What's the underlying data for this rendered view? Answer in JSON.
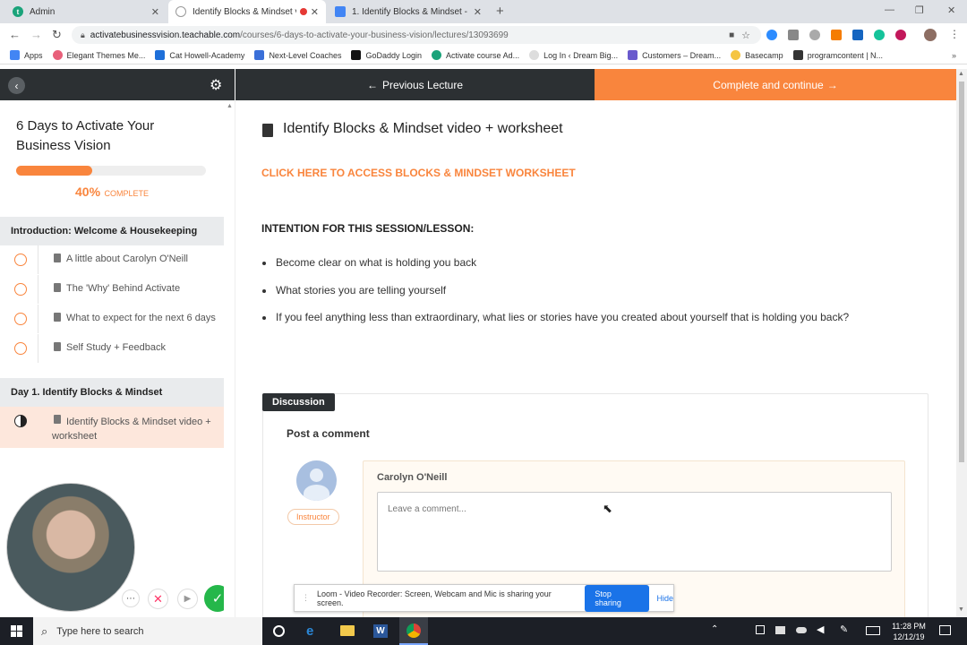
{
  "browser": {
    "tabs": [
      {
        "title": "Admin",
        "favicon_color": "#1aa37a",
        "favicon_glyph": "t"
      },
      {
        "title": "Identify Blocks & Mindset vi",
        "favicon_color": "#ffffff",
        "favicon_glyph": ""
      },
      {
        "title": "1. Identify Blocks & Mindset - Go",
        "favicon_color": "#4285f4",
        "favicon_glyph": ""
      }
    ],
    "url_host": "activatebusinessvision.teachable.com",
    "url_path": "/courses/6-days-to-activate-your-business-vision/lectures/13093699",
    "bookmarks": [
      {
        "label": "Apps",
        "color": "#4285f4"
      },
      {
        "label": "Elegant Themes Me...",
        "color": "#e8607a"
      },
      {
        "label": "Cat Howell-Academy",
        "color": "#1e6fd9"
      },
      {
        "label": "Next-Level Coaches",
        "color": "#3a6fd8"
      },
      {
        "label": "GoDaddy Login",
        "color": "#111111"
      },
      {
        "label": "Activate course Ad...",
        "color": "#1aa37a"
      },
      {
        "label": "Log In ‹ Dream Big...",
        "color": "#cccccc"
      },
      {
        "label": "Customers – Dream...",
        "color": "#6a5acd"
      },
      {
        "label": "Basecamp",
        "color": "#f5c542"
      },
      {
        "label": "programcontent | N...",
        "color": "#333333"
      }
    ]
  },
  "nav": {
    "prev_label": "Previous Lecture",
    "next_label": "Complete and continue"
  },
  "sidebar": {
    "course_title": "6 Days to Activate Your Business Vision",
    "progress_percent": "40%",
    "progress_label": "COMPLETE",
    "progress_value": 0.4,
    "sections": [
      {
        "title": "Introduction: Welcome & Housekeeping",
        "items": [
          "A little about Carolyn O'Neill",
          "The 'Why' Behind Activate",
          "What to expect for the next 6 days",
          "Self Study + Feedback"
        ]
      },
      {
        "title": "Day 1. Identify Blocks & Mindset",
        "items": [
          "Identify Blocks & Mindset video + worksheet"
        ]
      }
    ]
  },
  "lecture": {
    "title": "Identify Blocks & Mindset video + worksheet",
    "worksheet_link": "CLICK HERE TO ACCESS BLOCKS & MINDSET WORKSHEET",
    "intention_heading": "INTENTION FOR THIS SESSION/LESSON:",
    "bullets": [
      "Become clear on what is holding you back",
      "What stories you are telling yourself",
      "If you feel anything less than extraordinary, what lies or stories have you created about yourself that is holding you back?"
    ]
  },
  "discussion": {
    "tab_label": "Discussion",
    "heading": "Post a comment",
    "author": "Carolyn O'Neill",
    "role_badge": "Instructor",
    "comment_placeholder": "Leave a comment..."
  },
  "loom": {
    "message": "Loom - Video Recorder: Screen, Webcam and Mic is sharing your screen.",
    "stop_label": "Stop sharing",
    "hide_label": "Hide"
  },
  "taskbar": {
    "search_placeholder": "Type here to search",
    "time": "11:28 PM",
    "date": "12/12/19"
  },
  "colors": {
    "accent": "#f9853d",
    "dark": "#2c3033"
  }
}
